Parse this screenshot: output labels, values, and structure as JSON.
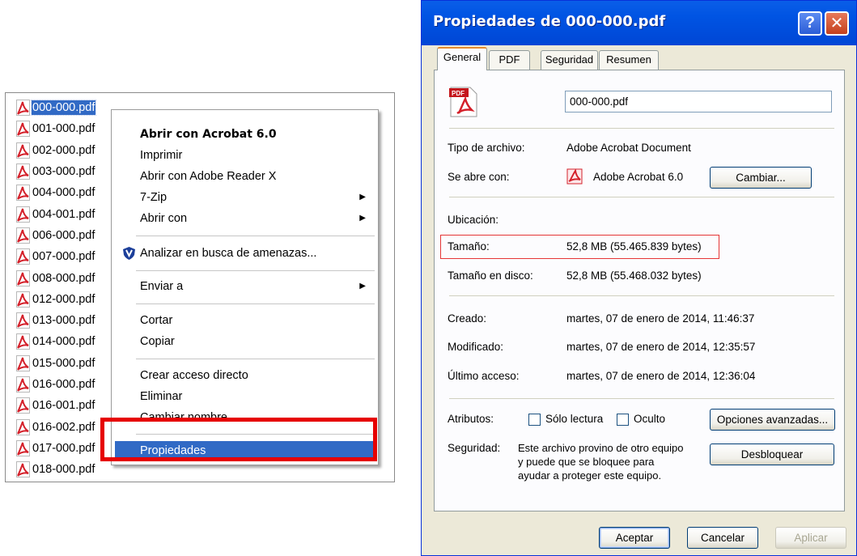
{
  "files": [
    {
      "name": "000-000.pdf",
      "selected": true
    },
    {
      "name": "001-000.pdf"
    },
    {
      "name": "002-000.pdf"
    },
    {
      "name": "003-000.pdf"
    },
    {
      "name": "004-000.pdf"
    },
    {
      "name": "004-001.pdf"
    },
    {
      "name": "006-000.pdf"
    },
    {
      "name": "007-000.pdf"
    },
    {
      "name": "008-000.pdf"
    },
    {
      "name": "012-000.pdf"
    },
    {
      "name": "013-000.pdf"
    },
    {
      "name": "014-000.pdf"
    },
    {
      "name": "015-000.pdf"
    },
    {
      "name": "016-000.pdf"
    },
    {
      "name": "016-001.pdf"
    },
    {
      "name": "016-002.pdf"
    },
    {
      "name": "017-000.pdf"
    },
    {
      "name": "018-000.pdf"
    }
  ],
  "context_menu": {
    "open_acrobat": "Abrir con Acrobat 6.0",
    "print": "Imprimir",
    "open_reader": "Abrir con Adobe Reader X",
    "seven_zip": "7-Zip",
    "open_with": "Abrir con",
    "scan": "Analizar en busca de amenazas...",
    "send_to": "Enviar a",
    "cut": "Cortar",
    "copy": "Copiar",
    "create_shortcut": "Crear acceso directo",
    "delete": "Eliminar",
    "rename": "Cambiar nombre",
    "properties": "Propiedades"
  },
  "dialog": {
    "title": "Propiedades de 000-000.pdf",
    "help_glyph": "?",
    "close_glyph": "✕",
    "tabs": [
      "General",
      "PDF",
      "Seguridad",
      "Resumen"
    ],
    "filename": "000-000.pdf",
    "file_type_label": "Tipo de archivo:",
    "file_type_value": "Adobe Acrobat Document",
    "opens_with_label": "Se abre con:",
    "opens_with_value": "Adobe Acrobat 6.0",
    "change_button": "Cambiar...",
    "location_label": "Ubicación:",
    "size_label": "Tamaño:",
    "size_value": "52,8 MB (55.465.839 bytes)",
    "size_on_disk_label": "Tamaño en disco:",
    "size_on_disk_value": "52,8 MB (55.468.032 bytes)",
    "created_label": "Creado:",
    "created_value": "martes, 07 de enero de 2014, 11:46:37",
    "modified_label": "Modificado:",
    "modified_value": "martes, 07 de enero de 2014, 12:35:57",
    "accessed_label": "Último acceso:",
    "accessed_value": "martes, 07 de enero de 2014, 12:36:04",
    "attributes_label": "Atributos:",
    "readonly_label": "Sólo lectura",
    "hidden_label": "Oculto",
    "advanced_button": "Opciones avanzadas...",
    "security_label": "Seguridad:",
    "security_text_1": "Este archivo provino de otro equipo",
    "security_text_2": "y puede que se bloquee para",
    "security_text_3": "ayudar a proteger este equipo.",
    "unblock_button": "Desbloquear",
    "ok_button": "Aceptar",
    "cancel_button": "Cancelar",
    "apply_button": "Aplicar"
  },
  "colors": {
    "selection": "#316ac5",
    "title_bar": "#0054e3",
    "dialog_bg": "#ece9d8",
    "highlight_red": "#e60000",
    "pdf_red": "#d4202a"
  },
  "icons": [
    "pdf-file-icon",
    "shield-icon",
    "submenu-arrow-icon",
    "acrobat-icon",
    "help-icon",
    "close-icon"
  ]
}
